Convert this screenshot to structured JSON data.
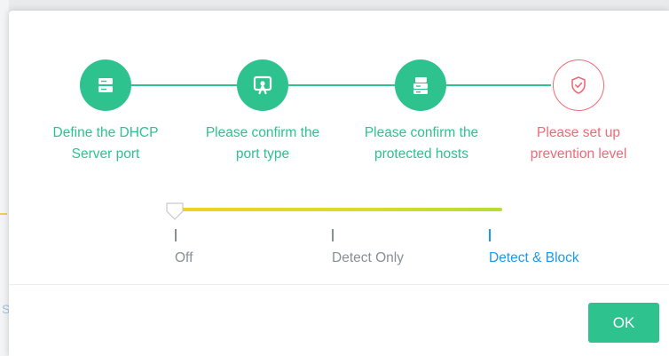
{
  "steps": [
    {
      "line1": "Define the DHCP",
      "line2": "Server port",
      "status": "done",
      "icon": "server-icon"
    },
    {
      "line1": "Please confirm the",
      "line2": "port type",
      "status": "done",
      "icon": "port-type-icon"
    },
    {
      "line1": "Please confirm the",
      "line2": "protected hosts",
      "status": "done",
      "icon": "hosts-icon"
    },
    {
      "line1": "Please set up",
      "line2": "prevention level",
      "status": "current",
      "icon": "shield-check-icon"
    }
  ],
  "prevention_slider": {
    "options": [
      "Off",
      "Detect Only",
      "Detect & Block"
    ],
    "highlighted_option": "Detect & Block"
  },
  "footer": {
    "ok_label": "OK"
  },
  "colors": {
    "done": "#2ec28f",
    "current": "#ef6a78",
    "option_active": "#1a9be8",
    "option_inactive": "#8a8f94"
  }
}
